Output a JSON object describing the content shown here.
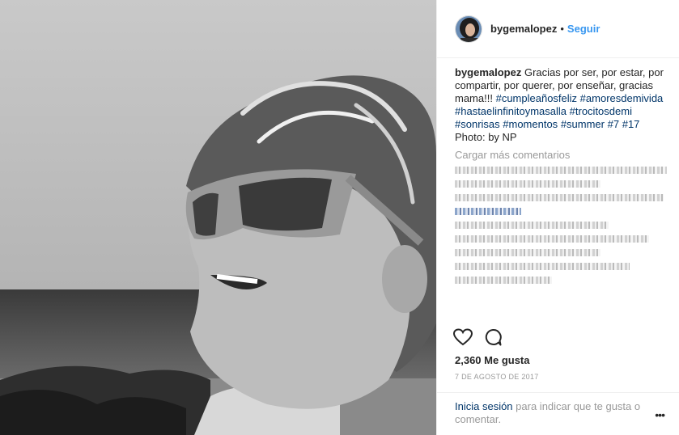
{
  "post": {
    "username": "bygemalopez",
    "separator": "•",
    "follow_label": "Seguir",
    "caption_username": "bygemalopez",
    "caption_text": "Gracias por ser, por estar, por compartir, por querer, por enseñar, gracias mama!!!",
    "hashtags": [
      "#cumpleañosfeliz",
      "#amoresdemivida",
      "#hastaelinfinitoymasalla",
      "#trocitosdemi",
      "#sonrisas",
      "#momentos",
      "#summer",
      "#7",
      "#17"
    ],
    "photo_credit": "Photo: by NP",
    "load_more": "Cargar más comentarios",
    "likes": "2,360 Me gusta",
    "date": "7 DE AGOSTO DE 2017",
    "login_link": "Inicia sesión",
    "login_text": "para indicar que te gusta o comentar.",
    "more_options": "•••"
  },
  "icons": {
    "like": "heart-outline-icon",
    "comment": "speech-bubble-icon",
    "options": "ellipsis-icon"
  }
}
